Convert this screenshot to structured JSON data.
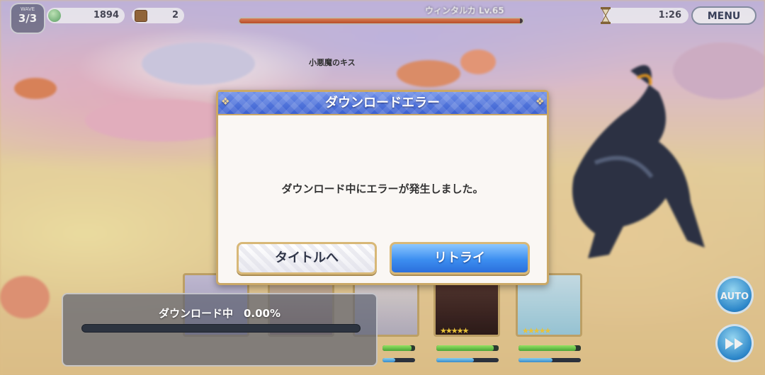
{
  "hud": {
    "wave_label": "WAVE",
    "wave": "3/3",
    "coins": "1894",
    "chests": "2",
    "boss_name": "ウィンタルカ Lv.65",
    "boss_hp_fraction": 0.99,
    "timer": "1:26",
    "menu_label": "MENU"
  },
  "battle": {
    "skill_name": "小悪魔のキス",
    "auto_label": "AUTO",
    "speed_icon": "fast-forward-icon"
  },
  "dialog": {
    "title": "ダウンロードエラー",
    "message": "ダウンロード中にエラーが発生しました。",
    "title_button": "タイトルへ",
    "retry_button": "リトライ"
  },
  "progress": {
    "label": "ダウンロード中　0.00%",
    "fraction": 0.0
  },
  "colors": {
    "dialog_header": "#3a5fd0",
    "retry_button": "#3c8ef0",
    "dialog_border": "#caa867"
  }
}
